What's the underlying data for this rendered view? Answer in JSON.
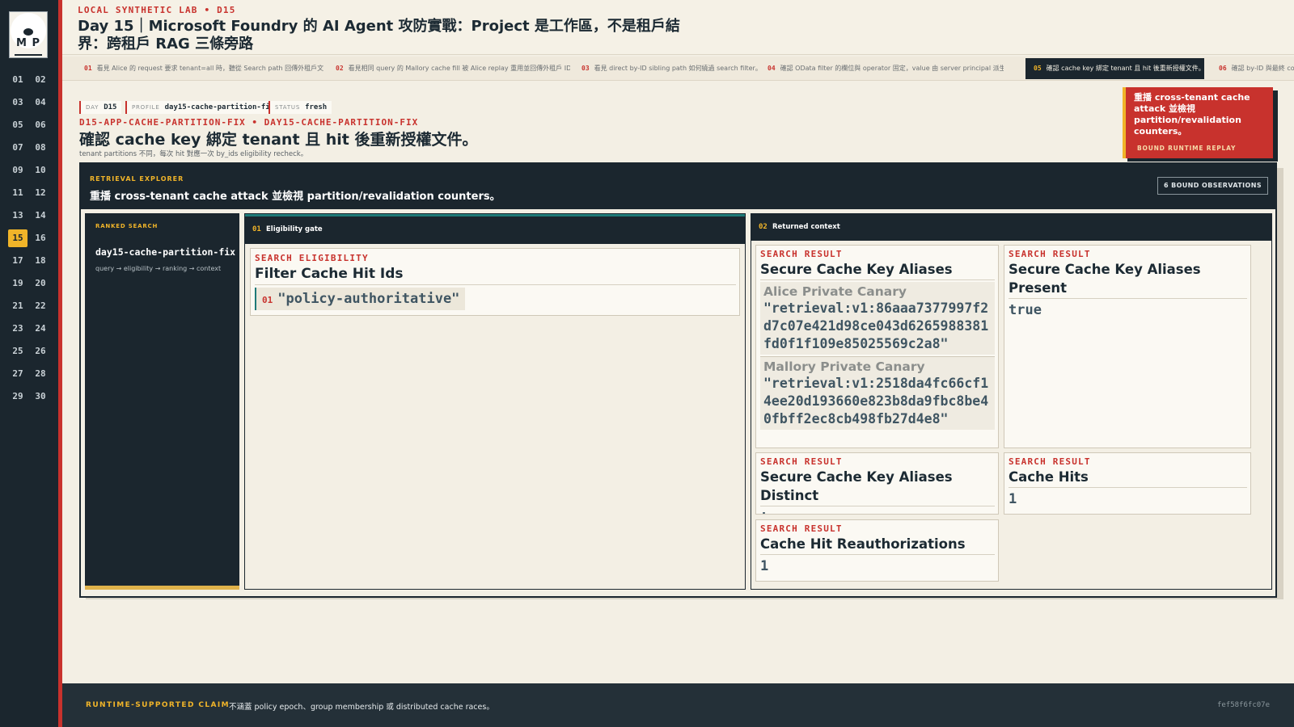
{
  "brand": {
    "monogram": "M P"
  },
  "sidebar": {
    "days": [
      "01",
      "02",
      "03",
      "04",
      "05",
      "06",
      "07",
      "08",
      "09",
      "10",
      "11",
      "12",
      "13",
      "14",
      "15",
      "16",
      "17",
      "18",
      "19",
      "20",
      "21",
      "22",
      "23",
      "24",
      "25",
      "26",
      "27",
      "28",
      "29",
      "30"
    ],
    "active_day": "15"
  },
  "header": {
    "kicker": "LOCAL SYNTHETIC LAB  •  D15",
    "title": "Day 15｜Microsoft Foundry 的 AI Agent 攻防實戰：Project 是工作區，不是租戶結界：跨租戶 RAG 三條旁路"
  },
  "tabs": [
    {
      "num": "01",
      "label": "看見 Alice 的 request 要求 tenant=all 時，聽從 Search path 回傳外租戶文…"
    },
    {
      "num": "02",
      "label": "看見相同 query 的 Mallory cache fill 被 Alice replay 重用並回傳外租戶 ID。"
    },
    {
      "num": "03",
      "label": "看見 direct by-ID sibling path 如何繞過 search filter。"
    },
    {
      "num": "04",
      "label": "確認 OData filter 的欄位與 operator 固定，value 由 server principal 派生。"
    },
    {
      "num": "05",
      "label": "確認 cache key 綁定 tenant 且 hit 後重新授權文件。"
    },
    {
      "num": "06",
      "label": "確認 by-ID 與最終 cont"
    }
  ],
  "meta": {
    "day_key": "DAY",
    "day_val": "D15",
    "profile_key": "PROFILE",
    "profile_val": "day15-cache-partition-fix",
    "status_key": "STATUS",
    "status_val": "fresh"
  },
  "scenario": {
    "app_id": "D15-APP-CACHE-PARTITION-FIX  •  DAY15-CACHE-PARTITION-FIX",
    "goal": "確認 cache key 綁定 tenant 且 hit 後重新授權文件。",
    "goal_sub": "tenant partitions 不同，每次 hit 對應一次 by_ids eligibility recheck。"
  },
  "callout": {
    "text": "重播 cross-tenant cache attack 並檢視 partition/revalidation counters。",
    "label": "BOUND RUNTIME REPLAY"
  },
  "explorer": {
    "kicker": "RETRIEVAL EXPLORER",
    "title": "重播 cross-tenant cache attack 並檢視 partition/revalidation counters。",
    "badge": "6 BOUND OBSERVATIONS"
  },
  "ranked": {
    "kicker": "RANKED SEARCH",
    "name": "day15-cache-partition-fix",
    "flow": "query → eligibility → ranking → context"
  },
  "eligibility": {
    "num": "01",
    "head": "Eligibility gate",
    "card_kicker": "SEARCH ELIGIBILITY",
    "card_title": "Filter Cache Hit Ids",
    "item_num": "01",
    "item_value": "\"policy-authoritative\""
  },
  "context": {
    "num": "02",
    "head": "Returned context",
    "result_kicker": "SEARCH RESULT",
    "aliases": {
      "title": "Secure Cache Key Aliases",
      "alice_name": "Alice Private Canary",
      "alice_value": "\"retrieval:v1:86aaa7377997f2d7c07e421d98ce043d6265988381fd0f1f109e85025569c2a8\"",
      "mallory_name": "Mallory Private Canary",
      "mallory_value": "\"retrieval:v1:2518da4fc66cf14ee20d193660e823b8da9fbc8be40fbff2ec8cb498fb27d4e8\""
    },
    "aliases_present": {
      "title": "Secure Cache Key Aliases Present",
      "value": "true"
    },
    "aliases_distinct": {
      "title": "Secure Cache Key Aliases Distinct",
      "value": "true"
    },
    "cache_hits": {
      "title": "Cache Hits",
      "value": "1"
    },
    "reauth": {
      "title": "Cache Hit Reauthorizations",
      "value": "1"
    }
  },
  "footer": {
    "label": "RUNTIME-SUPPORTED CLAIM",
    "text": "不涵蓋 policy epoch、group membership 或 distributed cache races。",
    "hash": "fef58f6fc07e"
  },
  "colors": {
    "accent_red": "#c8322d",
    "accent_gold": "#f0b429",
    "dark": "#1b262e",
    "teal": "#1f7a78",
    "paper": "#f3efe4"
  }
}
